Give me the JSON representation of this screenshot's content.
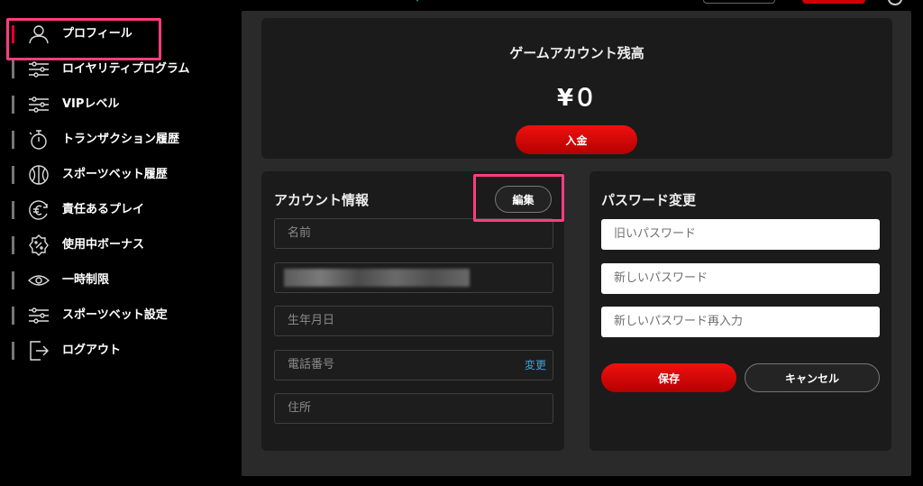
{
  "sidebar": {
    "items": [
      {
        "label": "プロフィール",
        "icon": "user-icon"
      },
      {
        "label": "ロイヤリティプログラム",
        "icon": "sliders-icon"
      },
      {
        "label": "VIPレベル",
        "icon": "sliders-icon"
      },
      {
        "label": "トランザクション履歴",
        "icon": "timer-icon"
      },
      {
        "label": "スポーツベット履歴",
        "icon": "ball-icon"
      },
      {
        "label": "責任あるプレイ",
        "icon": "euro-coin-icon"
      },
      {
        "label": "使用中ボーナス",
        "icon": "percent-badge-icon"
      },
      {
        "label": "一時制限",
        "icon": "eye-icon"
      },
      {
        "label": "スポーツベット設定",
        "icon": "sliders-icon"
      },
      {
        "label": "ログアウト",
        "icon": "logout-icon"
      }
    ],
    "active_index": 0
  },
  "balance": {
    "title": "ゲームアカウント残高",
    "amount": "¥０",
    "deposit_label": "入金"
  },
  "account": {
    "title": "アカウント情報",
    "edit_label": "編集",
    "fields": {
      "name_placeholder": "名前",
      "dob_placeholder": "生年月日",
      "phone_placeholder": "電話番号",
      "phone_change_link": "変更",
      "address_placeholder": "住所"
    }
  },
  "password": {
    "title": "パスワード変更",
    "old_placeholder": "旧いパスワード",
    "new_placeholder": "新しいパスワード",
    "confirm_placeholder": "新しいパスワード再入力",
    "save_label": "保存",
    "cancel_label": "キャンセル"
  },
  "colors": {
    "accent_red": "#e60000",
    "highlight_pink": "#ff3d7f",
    "link_blue": "#38a6e8",
    "panel_bg": "#2a2a2a",
    "card_bg": "#1b1b1b"
  }
}
